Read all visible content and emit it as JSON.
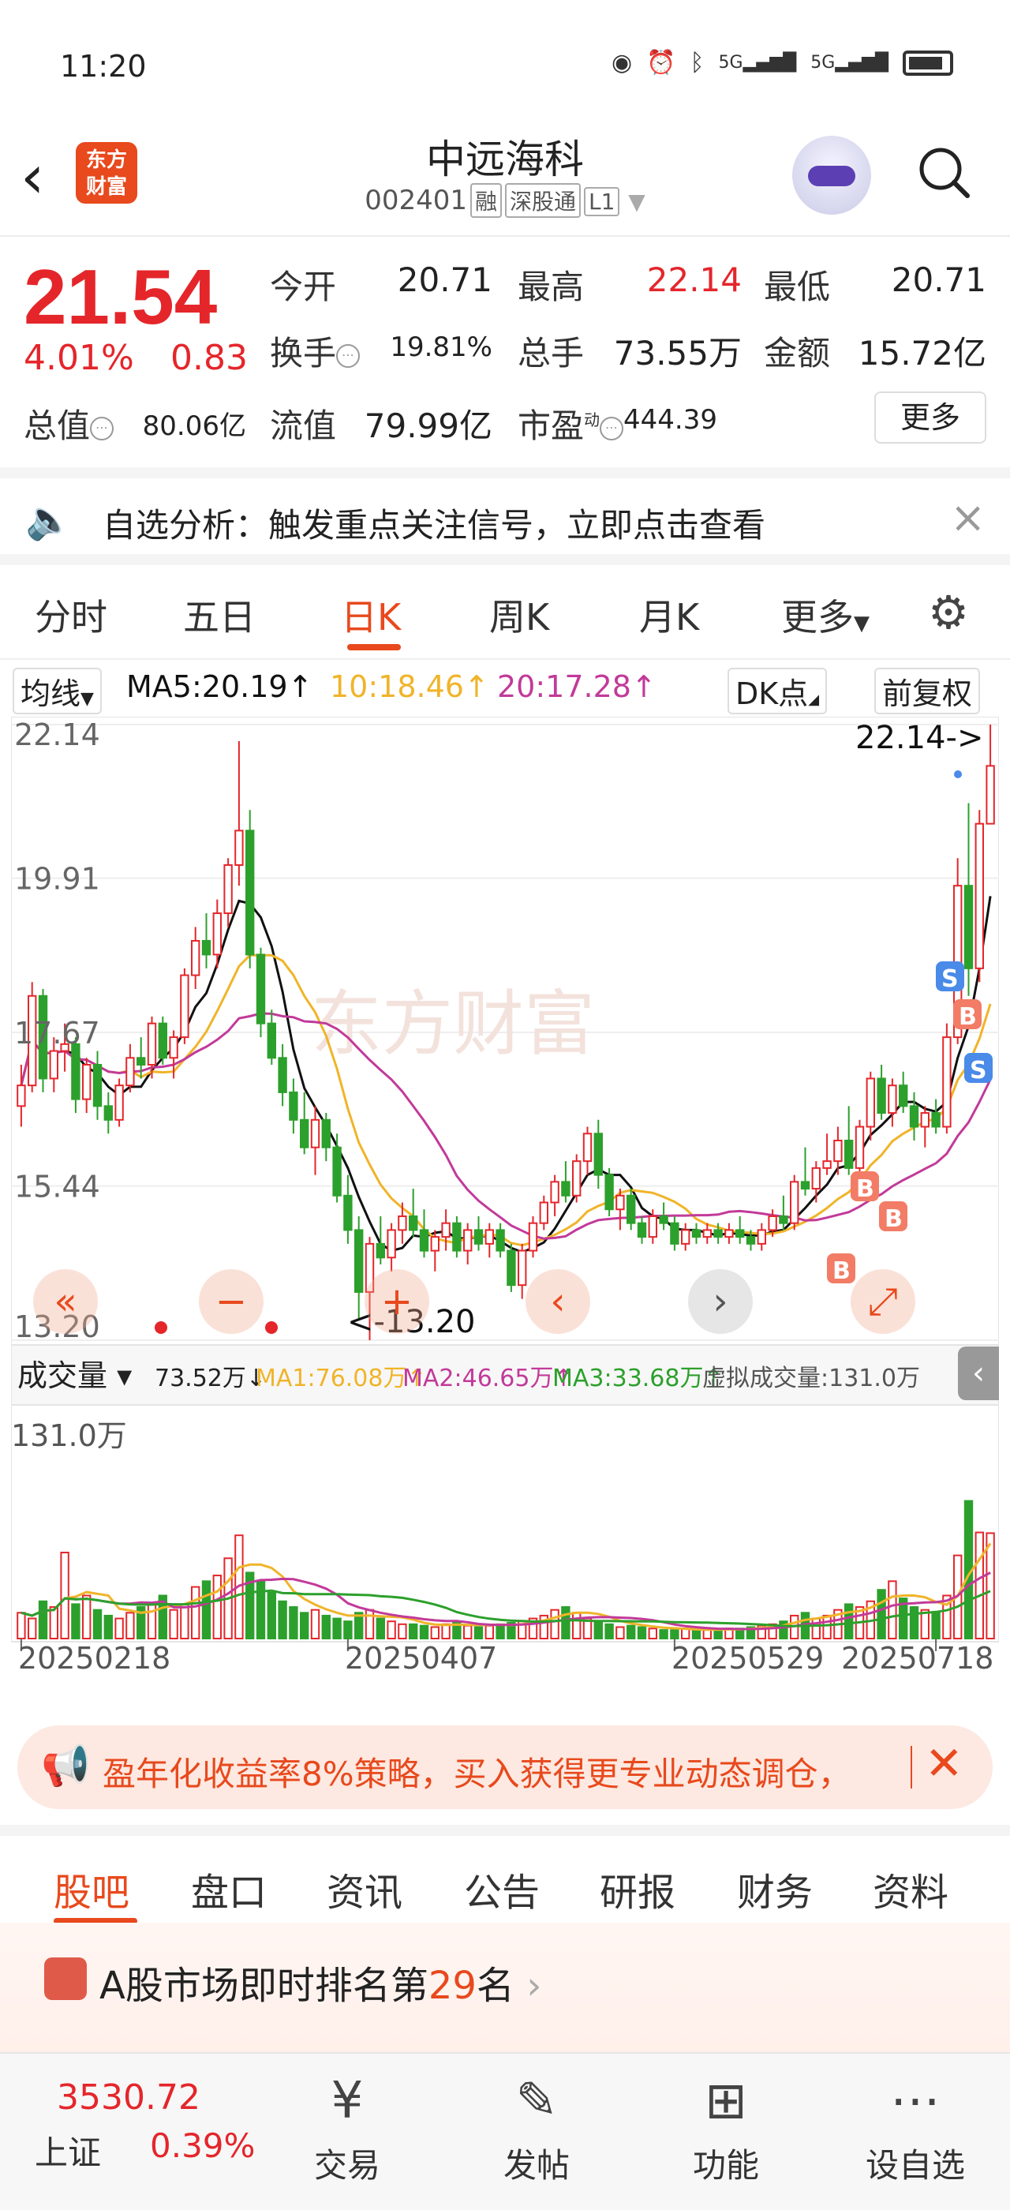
{
  "status": {
    "time": "11:20",
    "net1": "5G",
    "net2": "5G"
  },
  "header": {
    "logo_line1": "东方",
    "logo_line2": "财富",
    "name": "中远海科",
    "code": "002401",
    "tags": [
      "融",
      "深股通",
      "L1"
    ]
  },
  "quote": {
    "price": "21.54",
    "pct": "4.01%",
    "change": "0.83",
    "rows": [
      [
        {
          "label": "今开",
          "value": "20.71"
        },
        {
          "label": "最高",
          "value": "22.14",
          "color": "red"
        },
        {
          "label": "最低",
          "value": "20.71"
        }
      ],
      [
        {
          "label": "换手",
          "value": "19.81%"
        },
        {
          "label": "总手",
          "value": "73.55万"
        },
        {
          "label": "金额",
          "value": "15.72亿"
        }
      ],
      [
        {
          "label": "总值",
          "value": "80.06亿"
        },
        {
          "label": "流值",
          "value": "79.99亿"
        },
        {
          "label": "市盈",
          "sup": "动",
          "value": "444.39"
        }
      ]
    ],
    "more": "更多"
  },
  "notice": {
    "text": "自选分析：触发重点关注信号，立即点击查看"
  },
  "tabs": [
    "分时",
    "五日",
    "日K",
    "周K",
    "月K",
    "更多"
  ],
  "active_tab": "日K",
  "ma_row": {
    "selector": "均线",
    "ma5": "MA5:20.19↑",
    "ma10": "10:18.46↑",
    "ma20": "20:17.28↑",
    "dk": "DK点",
    "adjust": "前复权"
  },
  "chart_data": [
    {
      "type": "candlestick",
      "y_ticks": [
        "22.14",
        "19.91",
        "17.67",
        "15.44",
        "13.20"
      ],
      "ylim": [
        13.2,
        22.14
      ],
      "high_label": "22.14->",
      "low_label": "<-13.20",
      "watermark": "东方财富",
      "candles": [
        [
          16.6,
          17.2,
          16.3,
          16.9
        ],
        [
          16.9,
          18.4,
          16.8,
          18.2
        ],
        [
          18.2,
          18.3,
          16.8,
          17.0
        ],
        [
          17.0,
          17.6,
          16.8,
          17.4
        ],
        [
          17.4,
          17.8,
          17.1,
          17.5
        ],
        [
          17.5,
          17.6,
          16.5,
          16.7
        ],
        [
          16.7,
          17.3,
          16.5,
          17.2
        ],
        [
          17.2,
          17.4,
          16.4,
          16.6
        ],
        [
          16.6,
          16.8,
          16.2,
          16.4
        ],
        [
          16.4,
          17.0,
          16.3,
          16.9
        ],
        [
          16.9,
          17.5,
          16.8,
          17.3
        ],
        [
          17.3,
          17.6,
          17.0,
          17.2
        ],
        [
          17.2,
          17.9,
          17.0,
          17.8
        ],
        [
          17.8,
          17.9,
          17.2,
          17.3
        ],
        [
          17.3,
          17.7,
          17.0,
          17.6
        ],
        [
          17.6,
          18.6,
          17.5,
          18.5
        ],
        [
          18.5,
          19.2,
          18.3,
          19.0
        ],
        [
          19.0,
          19.4,
          18.6,
          18.8
        ],
        [
          18.8,
          19.6,
          18.6,
          19.4
        ],
        [
          19.4,
          20.2,
          19.2,
          20.1
        ],
        [
          20.1,
          21.9,
          19.8,
          20.6
        ],
        [
          20.6,
          20.9,
          18.6,
          18.8
        ],
        [
          18.8,
          18.9,
          17.6,
          17.8
        ],
        [
          17.8,
          18.0,
          17.2,
          17.3
        ],
        [
          17.3,
          17.5,
          16.6,
          16.8
        ],
        [
          16.8,
          17.0,
          16.2,
          16.4
        ],
        [
          16.4,
          16.8,
          15.9,
          16.0
        ],
        [
          16.0,
          16.6,
          15.6,
          16.4
        ],
        [
          16.4,
          16.5,
          15.8,
          16.0
        ],
        [
          16.0,
          16.2,
          15.2,
          15.3
        ],
        [
          15.3,
          15.6,
          14.6,
          14.8
        ],
        [
          14.8,
          15.0,
          13.5,
          13.9
        ],
        [
          13.9,
          14.7,
          13.2,
          14.6
        ],
        [
          14.6,
          15.0,
          14.3,
          14.4
        ],
        [
          14.4,
          14.9,
          14.2,
          14.8
        ],
        [
          14.8,
          15.2,
          14.6,
          15.0
        ],
        [
          15.0,
          15.4,
          14.7,
          14.8
        ],
        [
          14.8,
          15.1,
          14.4,
          14.5
        ],
        [
          14.5,
          14.8,
          14.2,
          14.7
        ],
        [
          14.7,
          15.1,
          14.5,
          14.9
        ],
        [
          14.9,
          15.0,
          14.4,
          14.5
        ],
        [
          14.5,
          14.9,
          14.3,
          14.8
        ],
        [
          14.8,
          15.0,
          14.5,
          14.6
        ],
        [
          14.6,
          14.9,
          14.4,
          14.8
        ],
        [
          14.8,
          14.9,
          14.4,
          14.5
        ],
        [
          14.5,
          14.6,
          13.9,
          14.0
        ],
        [
          14.0,
          14.6,
          13.8,
          14.5
        ],
        [
          14.5,
          15.0,
          14.4,
          14.9
        ],
        [
          14.9,
          15.3,
          14.8,
          15.2
        ],
        [
          15.2,
          15.6,
          15.0,
          15.5
        ],
        [
          15.5,
          15.8,
          15.2,
          15.3
        ],
        [
          15.3,
          15.9,
          15.2,
          15.8
        ],
        [
          15.8,
          16.3,
          15.6,
          16.2
        ],
        [
          16.2,
          16.4,
          15.4,
          15.6
        ],
        [
          15.6,
          15.7,
          15.0,
          15.1
        ],
        [
          15.1,
          15.4,
          14.8,
          15.3
        ],
        [
          15.3,
          15.4,
          14.8,
          14.9
        ],
        [
          14.9,
          15.0,
          14.6,
          14.7
        ],
        [
          14.7,
          15.1,
          14.6,
          15.0
        ],
        [
          15.0,
          15.2,
          14.8,
          14.9
        ],
        [
          14.9,
          15.0,
          14.5,
          14.6
        ],
        [
          14.6,
          14.9,
          14.5,
          14.8
        ],
        [
          14.8,
          14.9,
          14.6,
          14.7
        ],
        [
          14.7,
          14.9,
          14.6,
          14.8
        ],
        [
          14.8,
          14.9,
          14.6,
          14.7
        ],
        [
          14.7,
          14.9,
          14.6,
          14.8
        ],
        [
          14.8,
          15.0,
          14.6,
          14.7
        ],
        [
          14.7,
          14.8,
          14.5,
          14.6
        ],
        [
          14.6,
          14.9,
          14.5,
          14.8
        ],
        [
          14.8,
          15.1,
          14.7,
          15.0
        ],
        [
          15.0,
          15.3,
          14.8,
          14.9
        ],
        [
          14.9,
          15.6,
          14.8,
          15.5
        ],
        [
          15.5,
          16.0,
          15.3,
          15.4
        ],
        [
          15.4,
          15.8,
          15.2,
          15.7
        ],
        [
          15.7,
          16.2,
          15.6,
          15.8
        ],
        [
          15.8,
          16.3,
          15.6,
          16.1
        ],
        [
          16.1,
          16.6,
          15.6,
          15.7
        ],
        [
          15.7,
          16.4,
          15.5,
          16.3
        ],
        [
          16.3,
          17.1,
          16.1,
          17.0
        ],
        [
          17.0,
          17.2,
          16.4,
          16.5
        ],
        [
          16.5,
          17.0,
          16.3,
          16.9
        ],
        [
          16.9,
          17.1,
          16.5,
          16.6
        ],
        [
          16.6,
          16.8,
          16.1,
          16.3
        ],
        [
          16.3,
          16.6,
          16.0,
          16.5
        ],
        [
          16.5,
          16.7,
          16.2,
          16.3
        ],
        [
          16.3,
          17.8,
          16.2,
          17.6
        ],
        [
          17.6,
          20.2,
          17.5,
          19.8
        ],
        [
          19.8,
          21.0,
          18.2,
          18.6
        ],
        [
          18.6,
          20.9,
          18.4,
          20.7
        ],
        [
          20.7,
          22.14,
          20.71,
          21.54
        ]
      ],
      "ma5_line": "MA5",
      "ma10_line": "MA10",
      "ma20_line": "MA20"
    },
    {
      "type": "bar",
      "title": "成交量",
      "values_label": "73.52万↓",
      "ma1": "MA1:76.08万↑",
      "ma2": "MA2:46.65万↑",
      "ma3": "MA3:33.68万↑",
      "virtual": "虚拟成交量:131.0万",
      "y_max_label": "131.0万",
      "ylim": [
        0,
        131.0
      ],
      "x_ticks": [
        "20250218",
        "20250407",
        "20250529",
        "20250718"
      ],
      "values": [
        18,
        14,
        26,
        22,
        60,
        24,
        30,
        20,
        16,
        14,
        18,
        22,
        24,
        30,
        20,
        24,
        36,
        40,
        44,
        56,
        72,
        46,
        40,
        32,
        26,
        22,
        18,
        20,
        16,
        14,
        12,
        18,
        20,
        14,
        12,
        10,
        10,
        9,
        8,
        10,
        12,
        9,
        8,
        9,
        10,
        11,
        12,
        14,
        16,
        20,
        22,
        18,
        14,
        12,
        10,
        8,
        9,
        8,
        7,
        6,
        6,
        7,
        6,
        6,
        6,
        7,
        7,
        8,
        9,
        10,
        12,
        16,
        18,
        14,
        16,
        20,
        24,
        22,
        26,
        34,
        40,
        28,
        22,
        20,
        18,
        30,
        58,
        96,
        74,
        73.52
      ]
    }
  ],
  "chart_controls": {
    "prev": "‹",
    "next": "›",
    "minus": "−",
    "plus": "+"
  },
  "signals": {
    "s": "S",
    "b": "B"
  },
  "banner": {
    "text": "盈年化收益率8%策略，买入获得更专业动态调仓，"
  },
  "bottom_tabs": [
    "股吧",
    "盘口",
    "资讯",
    "公告",
    "研报",
    "财务",
    "资料"
  ],
  "rank": {
    "prefix": "A股市场即时排名第",
    "rank": "29",
    "suffix": "名"
  },
  "index": {
    "value": "3530.72",
    "name": "上证",
    "pct": "0.39%"
  },
  "nav": [
    {
      "icon": "trade-icon",
      "label": "交易"
    },
    {
      "icon": "post-icon",
      "label": "发帖"
    },
    {
      "icon": "function-icon",
      "label": "功能"
    },
    {
      "icon": "watchlist-icon",
      "label": "设自选"
    }
  ],
  "colors": {
    "up": "#e4262b",
    "down": "#2ca02c",
    "accent": "#e8491d",
    "ma5": "#111111",
    "ma10": "#f0b429",
    "ma20": "#c23a9a"
  }
}
